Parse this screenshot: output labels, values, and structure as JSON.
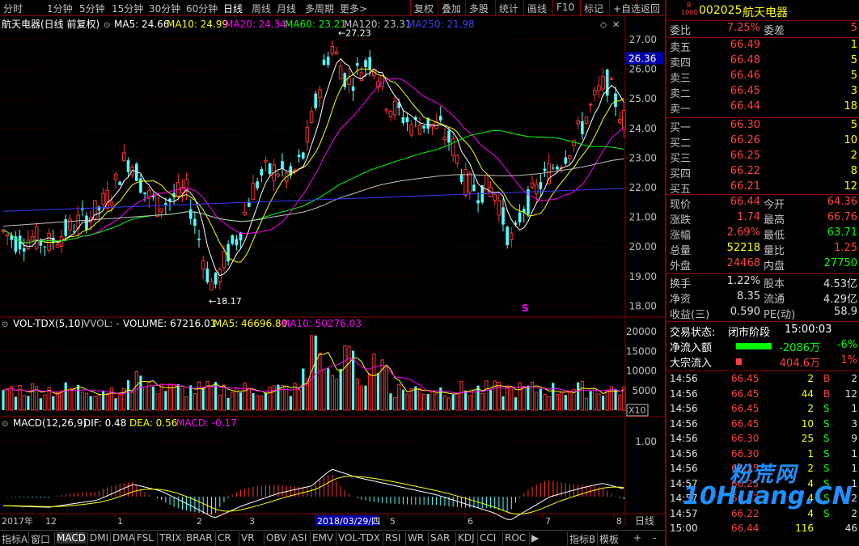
{
  "toolbar": {
    "periods": [
      "分时",
      "1分钟",
      "5分钟",
      "15分钟",
      "30分钟",
      "60分钟",
      "日线",
      "周线",
      "月线",
      "多周期",
      "更多>"
    ],
    "active_period": "日线",
    "tools": [
      "复权",
      "叠加",
      "多股",
      "统计",
      "画线",
      "F10",
      "标记",
      "+自选",
      "返回"
    ]
  },
  "price_panel": {
    "title": "航天电器(日线 前复权)",
    "ma_labels": [
      {
        "text": "MA5: 24.66",
        "color": "#ffffff"
      },
      {
        "text": "MA10: 24.99",
        "color": "#ffff00"
      },
      {
        "text": "MA20: 24.34",
        "color": "#ff00ff"
      },
      {
        "text": "MA60: 23.21",
        "color": "#00ff00"
      },
      {
        "text": "MA120: 23.31",
        "color": "#c0c0c0"
      },
      {
        "text": "MA250: 21.98",
        "color": "#4040ff"
      }
    ],
    "y_ticks": [
      "27.00",
      "26.00",
      "25.00",
      "24.00",
      "23.00",
      "22.00",
      "21.00",
      "20.00",
      "19.00",
      "18.00"
    ],
    "current_price_tag": "26.36",
    "high_annotation": "27.23",
    "low_annotation": "18.17",
    "marker": "S"
  },
  "volume_panel": {
    "title": "VOL-TDX(5,10)",
    "labels": [
      {
        "text": "VVOL: -",
        "color": "#c0c0c0"
      },
      {
        "text": "VOLUME: 67216.01",
        "color": "#ffffff"
      },
      {
        "text": "MA5: 46696.80",
        "color": "#ffff00"
      },
      {
        "text": "MA10: 50276.03",
        "color": "#ff00ff"
      }
    ],
    "y_ticks": [
      "20000",
      "15000",
      "10000",
      "5000"
    ],
    "unit": "X10"
  },
  "macd_panel": {
    "title": "MACD(12,26,9)",
    "labels": [
      {
        "text": "DIF: 0.48",
        "color": "#ffffff"
      },
      {
        "text": "DEA: 0.56",
        "color": "#ffff00"
      },
      {
        "text": "MACD: -0.17",
        "color": "#ff00ff"
      }
    ],
    "y_tick": "1.00"
  },
  "x_axis": {
    "labels": [
      "2017年",
      "12",
      "1",
      "2",
      "3",
      "2018/03/29/四",
      "5",
      "6",
      "7",
      "8"
    ],
    "period": "日线"
  },
  "bottom_tabs": {
    "items": [
      "指标A",
      "窗口",
      "MACD",
      "DMI",
      "DMA",
      "FSL",
      "TRIX",
      "BRAR",
      "CR",
      "VR",
      "OBV",
      "ASI",
      "EMV",
      "VOL-TDX",
      "RSI",
      "WR",
      "SAR",
      "KDJ",
      "CCI",
      "ROC",
      "▶",
      "指标B",
      "模板",
      "+",
      "-"
    ],
    "active": "MACD"
  },
  "quote": {
    "code": "002025",
    "name": "航天电器",
    "badge_top": "R",
    "badge_bottom": "1000",
    "weibi_label": "委比",
    "weibi": "7.25%",
    "weicha_label": "委差",
    "weicha": "5",
    "asks": [
      {
        "label": "卖五",
        "price": "66.49",
        "vol": "1"
      },
      {
        "label": "卖四",
        "price": "66.48",
        "vol": "5"
      },
      {
        "label": "卖三",
        "price": "66.46",
        "vol": "5"
      },
      {
        "label": "卖二",
        "price": "66.45",
        "vol": "3"
      },
      {
        "label": "卖一",
        "price": "66.44",
        "vol": "18"
      }
    ],
    "bids": [
      {
        "label": "买一",
        "price": "66.30",
        "vol": "5"
      },
      {
        "label": "买二",
        "price": "66.26",
        "vol": "10"
      },
      {
        "label": "买三",
        "price": "66.25",
        "vol": "2"
      },
      {
        "label": "买四",
        "price": "66.22",
        "vol": "8"
      },
      {
        "label": "买五",
        "price": "66.21",
        "vol": "12"
      }
    ],
    "stats": [
      {
        "l1": "现价",
        "v1": "66.44",
        "c1": "#ff4040",
        "l2": "今开",
        "v2": "64.36",
        "c2": "#ff4040"
      },
      {
        "l1": "涨跌",
        "v1": "1.74",
        "c1": "#ff4040",
        "l2": "最高",
        "v2": "66.76",
        "c2": "#ff4040"
      },
      {
        "l1": "涨幅",
        "v1": "2.69%",
        "c1": "#ff4040",
        "l2": "最低",
        "v2": "63.71",
        "c2": "#00ff00"
      },
      {
        "l1": "总量",
        "v1": "52218",
        "c1": "#ffff00",
        "l2": "量比",
        "v2": "1.25",
        "c2": "#ff4040"
      },
      {
        "l1": "外盘",
        "v1": "24468",
        "c1": "#ff4040",
        "l2": "内盘",
        "v2": "27750",
        "c2": "#00ff00"
      }
    ],
    "stats2": [
      {
        "l1": "换手",
        "v1": "1.22%",
        "l2": "股本",
        "v2": "4.53亿"
      },
      {
        "l1": "净资",
        "v1": "8.35",
        "l2": "流通",
        "v2": "4.29亿"
      },
      {
        "l1": "收益(三)",
        "v1": "0.590",
        "l2": "PE(动)",
        "v2": "58.9"
      }
    ],
    "trade_status_label": "交易状态:",
    "trade_status": "闭市阶段",
    "trade_time": "15:00:03",
    "netflow_label": "净流入额",
    "netflow_value": "-2086万",
    "netflow_pct": "-6%",
    "block_label": "大宗流入",
    "block_value": "404.6万",
    "block_pct": "1%",
    "ticks": [
      {
        "time": "14:56",
        "price": "66.45",
        "vol": "2",
        "side": "B",
        "n": "2"
      },
      {
        "time": "14:56",
        "price": "66.45",
        "vol": "44",
        "side": "B",
        "n": "12"
      },
      {
        "time": "14:56",
        "price": "66.45",
        "vol": "2",
        "side": "S",
        "n": "1"
      },
      {
        "time": "14:56",
        "price": "66.45",
        "vol": "10",
        "side": "S",
        "n": "3"
      },
      {
        "time": "14:56",
        "price": "66.30",
        "vol": "25",
        "side": "S",
        "n": "9"
      },
      {
        "time": "14:56",
        "price": "66.30",
        "vol": "1",
        "side": "S",
        "n": "1"
      },
      {
        "time": "14:56",
        "price": "66.25",
        "vol": "2",
        "side": "S",
        "n": "1"
      },
      {
        "time": "14:57",
        "price": "66.25",
        "vol": "4",
        "side": "S",
        "n": "1"
      },
      {
        "time": "14:57",
        "price": "66.22",
        "vol": "4",
        "side": "S",
        "n": "2"
      },
      {
        "time": "14:57",
        "price": "66.22",
        "vol": "4",
        "side": "S",
        "n": "2"
      },
      {
        "time": "15:00",
        "price": "66.44",
        "vol": "116",
        "side": "",
        "n": "46"
      }
    ],
    "watermark_main": "粉荒网",
    "watermark_sub": "10Huang.CN"
  }
}
